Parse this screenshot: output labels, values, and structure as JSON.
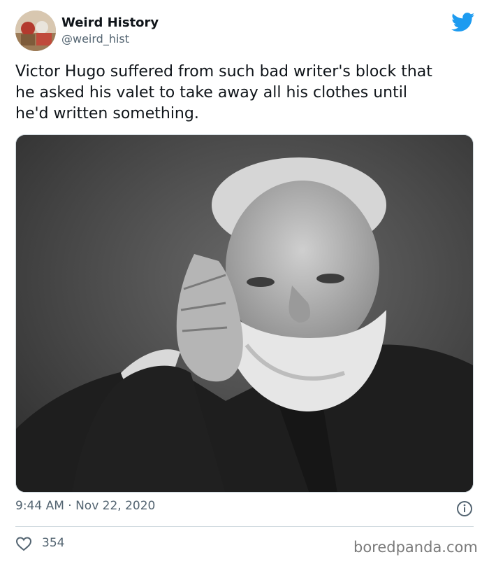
{
  "author": {
    "name": "Weird History",
    "handle": "@weird_hist",
    "avatar_icon": "vintage-photo-avatar"
  },
  "brand": {
    "icon": "twitter-bird-icon",
    "color": "#1d9bf0"
  },
  "tweet": {
    "text": "Victor Hugo suffered from such bad writer's block that\nhe asked his valet to take away all his clothes until\nhe'd written something.",
    "timestamp": "9:44 AM · Nov 22, 2020",
    "likes": "354"
  },
  "media": {
    "type": "black-and-white portrait photograph"
  },
  "icons": {
    "info": "info-icon",
    "like": "heart-icon"
  },
  "watermark": "boredpanda.com"
}
